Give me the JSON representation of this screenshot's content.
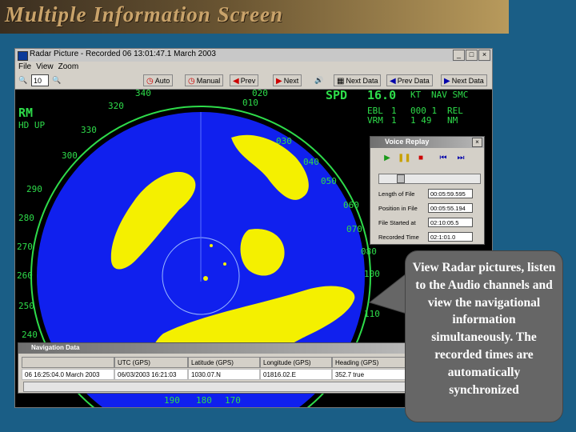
{
  "slide": {
    "title": "Multiple Information Screen"
  },
  "window": {
    "title": "Radar Picture  -  Recorded  06 13:01:47.1  March 2003",
    "controls": [
      "_",
      "□",
      "×"
    ],
    "menu": [
      "File",
      "View",
      "Zoom"
    ]
  },
  "toolbar": {
    "zoom_value": "10",
    "auto_label": "Auto",
    "manual_label": "Manual",
    "prev_label": "Prev",
    "next_label": "Next",
    "next_data_label": "Next Data",
    "prev_data_label": "Prev Data",
    "next_data2_label": "Next Data"
  },
  "radar": {
    "mode": "RM",
    "orientation": "HD UP",
    "speed_label": "SPD",
    "speed_value": "16.0",
    "speed_unit": "KT",
    "speed_mode": "NAV SMC",
    "ebl_label": "EBL",
    "ebl_value": "1",
    "ebl_reading": "000 1",
    "ebl_rel": "REL",
    "vrm_label": "VRM",
    "vrm_value": "1",
    "vrm_reading": "1 49",
    "vrm_unit": "NM",
    "bearings": [
      "320",
      "330",
      "340",
      "010",
      "020",
      "030",
      "040",
      "050",
      "060",
      "070",
      "080",
      "100",
      "110",
      "120",
      "300",
      "290",
      "280",
      "270",
      "260",
      "250",
      "240",
      "190",
      "180",
      "170"
    ],
    "colors": {
      "sweep": "#1020ee",
      "echo": "#f4f000",
      "overlay": "#2edc4a"
    }
  },
  "voice_replay": {
    "title": "Voice Replay",
    "labels": [
      "Length of File",
      "Position in File",
      "File Started at",
      "Recorded Time"
    ],
    "values": [
      "00:05:59.595",
      "00:05:55.194",
      "02:10:05.5",
      "02:1:01.0"
    ]
  },
  "navigation": {
    "title": "Navigation Data",
    "headers": [
      "",
      "UTC (GPS)",
      "Latitude (GPS)",
      "Longitude (GPS)",
      "Heading (GPS)"
    ],
    "row": [
      "06 16:25:04.0  March 2003",
      "06/03/2003 16:21:03",
      "1030.07.N",
      "01816.02.E",
      "352.7 true"
    ]
  },
  "callout": {
    "text": "View Radar pictures, listen to the Audio channels and view the navigational information simultaneously. The recorded times are automatically synchronized"
  }
}
